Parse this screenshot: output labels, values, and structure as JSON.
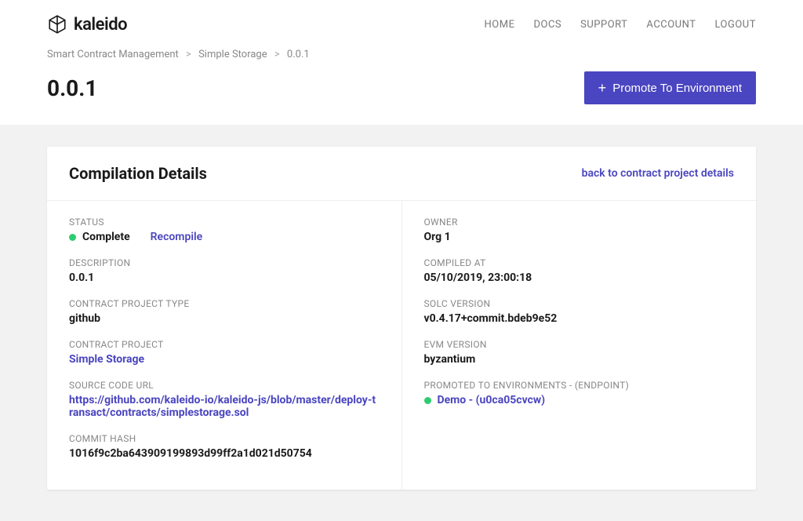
{
  "brand": {
    "name": "kaleido"
  },
  "nav": {
    "home": "HOME",
    "docs": "DOCS",
    "support": "SUPPORT",
    "account": "ACCOUNT",
    "logout": "LOGOUT"
  },
  "breadcrumb": {
    "root": "Smart Contract Management",
    "level1": "Simple Storage",
    "level2": "0.0.1"
  },
  "page": {
    "title": "0.0.1",
    "promoteButton": "Promote To Environment"
  },
  "card": {
    "title": "Compilation Details",
    "backLink": "back to contract project details"
  },
  "left": {
    "statusLabel": "STATUS",
    "statusValue": "Complete",
    "recompile": "Recompile",
    "descriptionLabel": "DESCRIPTION",
    "descriptionValue": "0.0.1",
    "projectTypeLabel": "CONTRACT PROJECT TYPE",
    "projectTypeValue": "github",
    "projectLabel": "CONTRACT PROJECT",
    "projectValue": "Simple Storage",
    "sourceLabel": "SOURCE CODE URL",
    "sourceValue": "https://github.com/kaleido-io/kaleido-js/blob/master/deploy-transact/contracts/simplestorage.sol",
    "commitLabel": "COMMIT HASH",
    "commitValue": "1016f9c2ba643909199893d99ff2a1d021d50754"
  },
  "right": {
    "ownerLabel": "OWNER",
    "ownerValue": "Org 1",
    "compiledLabel": "COMPILED AT",
    "compiledValue": "05/10/2019, 23:00:18",
    "solcLabel": "SOLC VERSION",
    "solcValue": "v0.4.17+commit.bdeb9e52",
    "evmLabel": "EVM VERSION",
    "evmValue": "byzantium",
    "envLabel": "PROMOTED TO ENVIRONMENTS - (ENDPOINT)",
    "envValue": "Demo - (u0ca05cvcw)"
  }
}
